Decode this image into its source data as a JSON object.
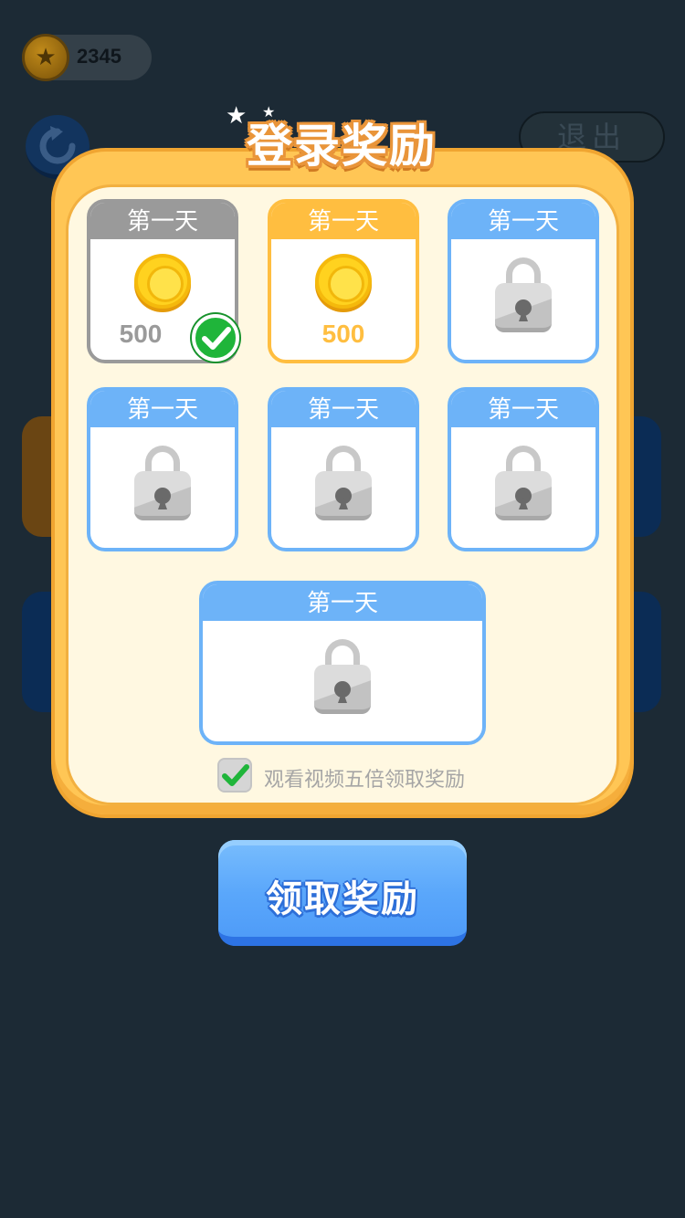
{
  "hud": {
    "coins": "2345",
    "exit_label": "退出",
    "coin_icon": "star-coin-icon",
    "refresh_icon": "refresh-icon"
  },
  "dialog": {
    "title": "登录奖励",
    "days": [
      {
        "label": "第一天",
        "state": "claimed",
        "reward": "500"
      },
      {
        "label": "第一天",
        "state": "current",
        "reward": "500"
      },
      {
        "label": "第一天",
        "state": "locked"
      },
      {
        "label": "第一天",
        "state": "locked"
      },
      {
        "label": "第一天",
        "state": "locked"
      },
      {
        "label": "第一天",
        "state": "locked"
      },
      {
        "label": "第一天",
        "state": "locked"
      }
    ],
    "video_option": {
      "label": "观看视频五倍领取奖励",
      "checked": true
    },
    "claim_button": "领取奖励"
  },
  "colors": {
    "claimed": "#9a9a9a",
    "current": "#ffbe40",
    "locked": "#6db3f8",
    "dialog": "#ffc655",
    "button": "#5aa7fb"
  }
}
